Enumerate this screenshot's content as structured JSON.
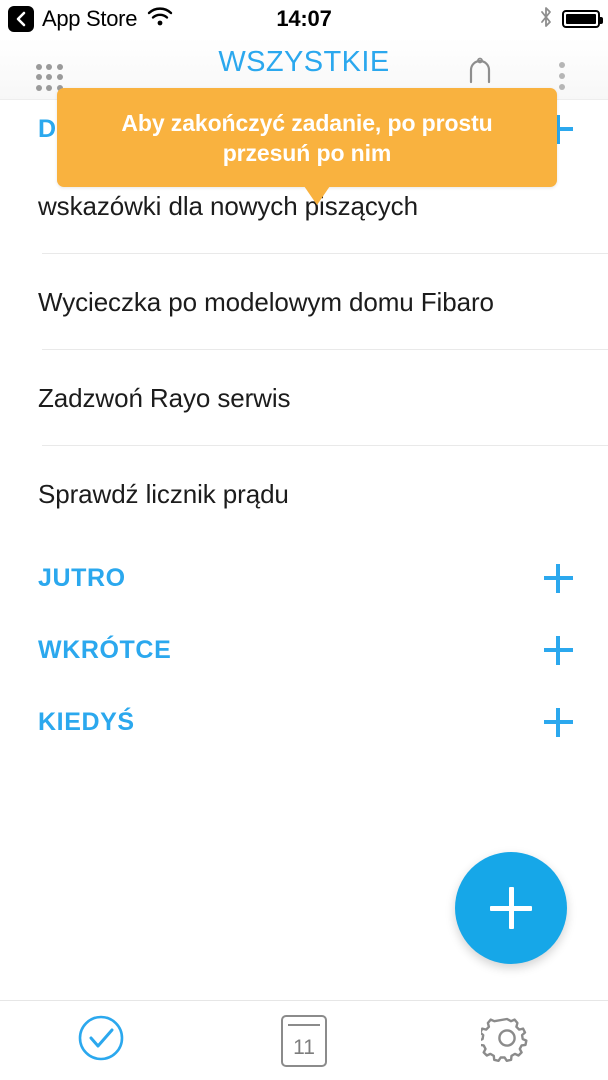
{
  "status_bar": {
    "back_icon": "chevron-left-icon",
    "app_name": "App Store",
    "wifi_icon": "wifi-icon",
    "time": "14:07",
    "bluetooth_icon": "bluetooth-icon",
    "battery_icon": "battery-full-icon"
  },
  "nav_bar": {
    "title": "WSZYSTKIE",
    "left_icon": "grid-menu-icon",
    "bell_icon": "bell-icon",
    "overflow_icon": "more-vertical-icon"
  },
  "tooltip": {
    "text": "Aby zakończyć zadanie, po prostu przesuń po nim",
    "background_color": "#f9b23f",
    "text_color": "#ffffff"
  },
  "sections": [
    {
      "title": "DZISIAJ",
      "add_label": "+",
      "tasks": [
        {
          "title": "wskazówki dla nowych piszących"
        },
        {
          "title": "Wycieczka po modelowym domu Fibaro"
        },
        {
          "title": "Zadzwoń Rayo serwis"
        },
        {
          "title": "Sprawdź licznik prądu"
        }
      ]
    },
    {
      "title": "JUTRO",
      "add_label": "+",
      "tasks": []
    },
    {
      "title": "WKRÓTCE",
      "add_label": "+",
      "tasks": []
    },
    {
      "title": "KIEDYŚ",
      "add_label": "+",
      "tasks": []
    }
  ],
  "fab": {
    "icon": "plus-icon",
    "color": "#16a7e8"
  },
  "tab_bar": {
    "items": [
      {
        "icon": "check-circle-icon",
        "active": true
      },
      {
        "icon": "calendar-icon",
        "day": "11",
        "active": false
      },
      {
        "icon": "gear-icon",
        "active": false
      }
    ]
  },
  "colors": {
    "accent": "#2ba8ee",
    "tooltip": "#f9b23f",
    "fab": "#16a7e8",
    "text": "#1c1c1c",
    "separator": "#e9e9e9"
  }
}
